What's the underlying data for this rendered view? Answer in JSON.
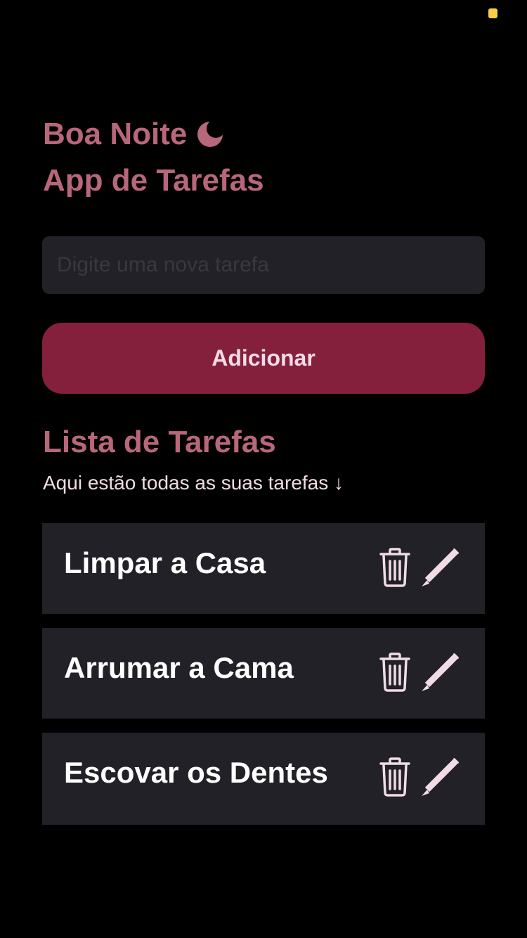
{
  "header": {
    "greeting": "Boa Noite",
    "greeting_icon": "moon-icon",
    "app_title": "App de Tarefas"
  },
  "form": {
    "input_placeholder": "Digite uma nova tarefa",
    "input_value": "",
    "add_button_label": "Adicionar"
  },
  "list": {
    "title": "Lista de Tarefas",
    "subtitle": "Aqui estão todas as suas tarefas ↓",
    "tasks": [
      {
        "text": "Limpar a Casa",
        "delete_icon": "trash-icon",
        "edit_icon": "pencil-icon"
      },
      {
        "text": "Arrumar a Cama",
        "delete_icon": "trash-icon",
        "edit_icon": "pencil-icon"
      },
      {
        "text": "Escovar os Dentes",
        "delete_icon": "trash-icon",
        "edit_icon": "pencil-icon"
      }
    ]
  },
  "colors": {
    "background": "#000000",
    "accent_text": "#B8677A",
    "primary_button": "#85203C",
    "card_background": "#212127",
    "icon_color": "#F1DCE6",
    "status_indicator": "#F7CE46"
  }
}
